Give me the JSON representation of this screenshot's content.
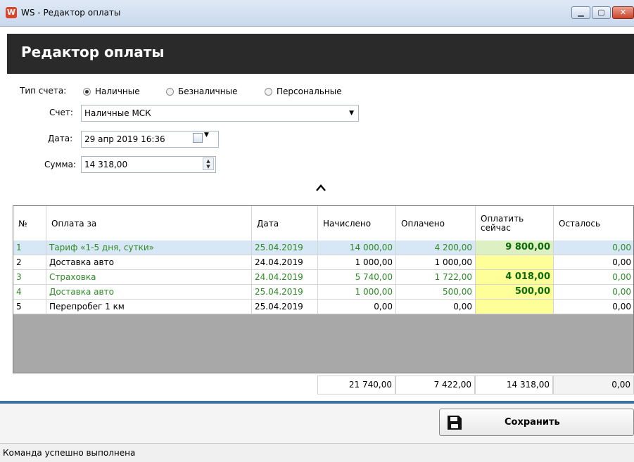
{
  "window": {
    "title": "WS - Редактор оплаты",
    "app_icon": "W",
    "min": "▁",
    "max": "▢",
    "close": "✕"
  },
  "header": {
    "title": "Редактор оплаты"
  },
  "form": {
    "account_type_label": "Тип счета:",
    "account_types": [
      {
        "label": "Наличные",
        "selected": true
      },
      {
        "label": "Безналичные",
        "selected": false
      },
      {
        "label": "Персональные",
        "selected": false
      }
    ],
    "account_label": "Счет:",
    "account_value": "Наличные МСК",
    "date_label": "Дата:",
    "date_value": "29 апр 2019  16:36",
    "sum_label": "Сумма:",
    "sum_value": "14 318,00"
  },
  "grid": {
    "columns": [
      "№",
      "Оплата за",
      "Дата",
      "Начислено",
      "Оплачено",
      "Оплатить сейчас",
      "Осталось"
    ],
    "rows": [
      {
        "no": "1",
        "item": "Тариф «1-5 дня, сутки»",
        "date": "25.04.2019",
        "charged": "14 000,00",
        "paid": "4 200,00",
        "pay_now": "9 800,00",
        "remaining": "0,00",
        "green": true,
        "selected": true
      },
      {
        "no": "2",
        "item": "Доставка авто",
        "date": "24.04.2019",
        "charged": "1 000,00",
        "paid": "1 000,00",
        "pay_now": "",
        "remaining": "0,00",
        "green": false,
        "selected": false
      },
      {
        "no": "3",
        "item": "Страховка",
        "date": "24.04.2019",
        "charged": "5 740,00",
        "paid": "1 722,00",
        "pay_now": "4 018,00",
        "remaining": "0,00",
        "green": true,
        "selected": false
      },
      {
        "no": "4",
        "item": "Доставка авто",
        "date": "25.04.2019",
        "charged": "1 000,00",
        "paid": "500,00",
        "pay_now": "500,00",
        "remaining": "0,00",
        "green": true,
        "selected": false
      },
      {
        "no": "5",
        "item": "Перепробег 1 км",
        "date": "25.04.2019",
        "charged": "0,00",
        "paid": "0,00",
        "pay_now": "",
        "remaining": "0,00",
        "green": false,
        "selected": false
      }
    ],
    "totals": {
      "charged": "21 740,00",
      "paid": "7 422,00",
      "pay_now": "14 318,00",
      "remaining": "0,00"
    }
  },
  "actions": {
    "save_label": "Сохранить"
  },
  "status": {
    "text": "Команда успешно выполнена"
  },
  "icons": {
    "collapse": "chevron-up-icon",
    "save": "floppy-disk-icon",
    "calendar": "calendar-icon"
  },
  "colors": {
    "header_bg": "#2a2a2a",
    "accent_bar": "#3d6fa3",
    "green_text": "#2d8a25",
    "pay_highlight": "#ffff99",
    "selected_row": "#d8e7f5"
  }
}
